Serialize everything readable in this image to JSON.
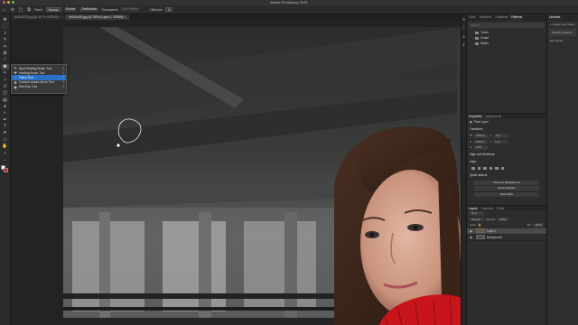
{
  "window": {
    "title": "Adobe Photoshop 2021"
  },
  "options_bar": {
    "patch_label": "Patch:",
    "patch_mode": "Normal",
    "source_label": "Source",
    "destination_label": "Destination",
    "transparent_label": "Transparent",
    "use_pattern_label": "Use Pattern",
    "diffusion_label": "Diffusion:",
    "diffusion_value": "5"
  },
  "tabs": [
    {
      "label": "IMG04329.jpg @ 66.7% (RGB/8) ×"
    },
    {
      "label": "IMG04400.jpg @ 100% (Layer 1, RGB/8) ×"
    }
  ],
  "tool_flyout": {
    "items": [
      {
        "label": "Spot Healing Brush Tool",
        "key": "J",
        "icon": "spot-heal-icon"
      },
      {
        "label": "Healing Brush Tool",
        "key": "J",
        "icon": "heal-brush-icon"
      },
      {
        "label": "Patch Tool",
        "key": "J",
        "icon": "patch-icon"
      },
      {
        "label": "Content-Aware Move Tool",
        "key": "J",
        "icon": "content-move-icon"
      },
      {
        "label": "Red Eye Tool",
        "key": "J",
        "icon": "red-eye-icon"
      }
    ]
  },
  "swatches_panel": {
    "tabs": [
      "Color",
      "Swatches",
      "Gradients",
      "Patterns"
    ],
    "search_placeholder": "Search",
    "groups": [
      "Trees",
      "Grass",
      "Water"
    ]
  },
  "properties_panel": {
    "tabs": [
      "Properties",
      "Adjustments"
    ],
    "layer_kind": "Pixel Layer",
    "transform_label": "Transform",
    "w_value": "3780 px",
    "h_value": "2400 px",
    "x_value": "0 px",
    "y_value": "0 px",
    "angle_value": "0.00°",
    "align_label": "Align and Distribute",
    "align_sub": "Align:",
    "quick_actions_label": "Quick Actions",
    "remove_bg": "Remove Background",
    "select_subject": "Select Subject",
    "view_more": "View More"
  },
  "layers_panel": {
    "tabs": [
      "Layers",
      "Channels",
      "Paths"
    ],
    "kind": "Kind",
    "blend_mode": "Normal",
    "opacity_label": "Opacity:",
    "opacity_value": "100%",
    "lock_label": "Lock:",
    "fill_label": "Fill:",
    "fill_value": "100%",
    "layers": [
      {
        "name": "Layer 1",
        "selected": true
      },
      {
        "name": "Background",
        "selected": false
      }
    ]
  },
  "libraries_panel": {
    "title": "Libraries",
    "new_library": "+ Create new library",
    "search_placeholder": "Search Libraries",
    "item": "My Library"
  },
  "colors": {
    "accent": "#2a6fc9",
    "foreground": "#ffffff",
    "background": "#c82a1f"
  }
}
